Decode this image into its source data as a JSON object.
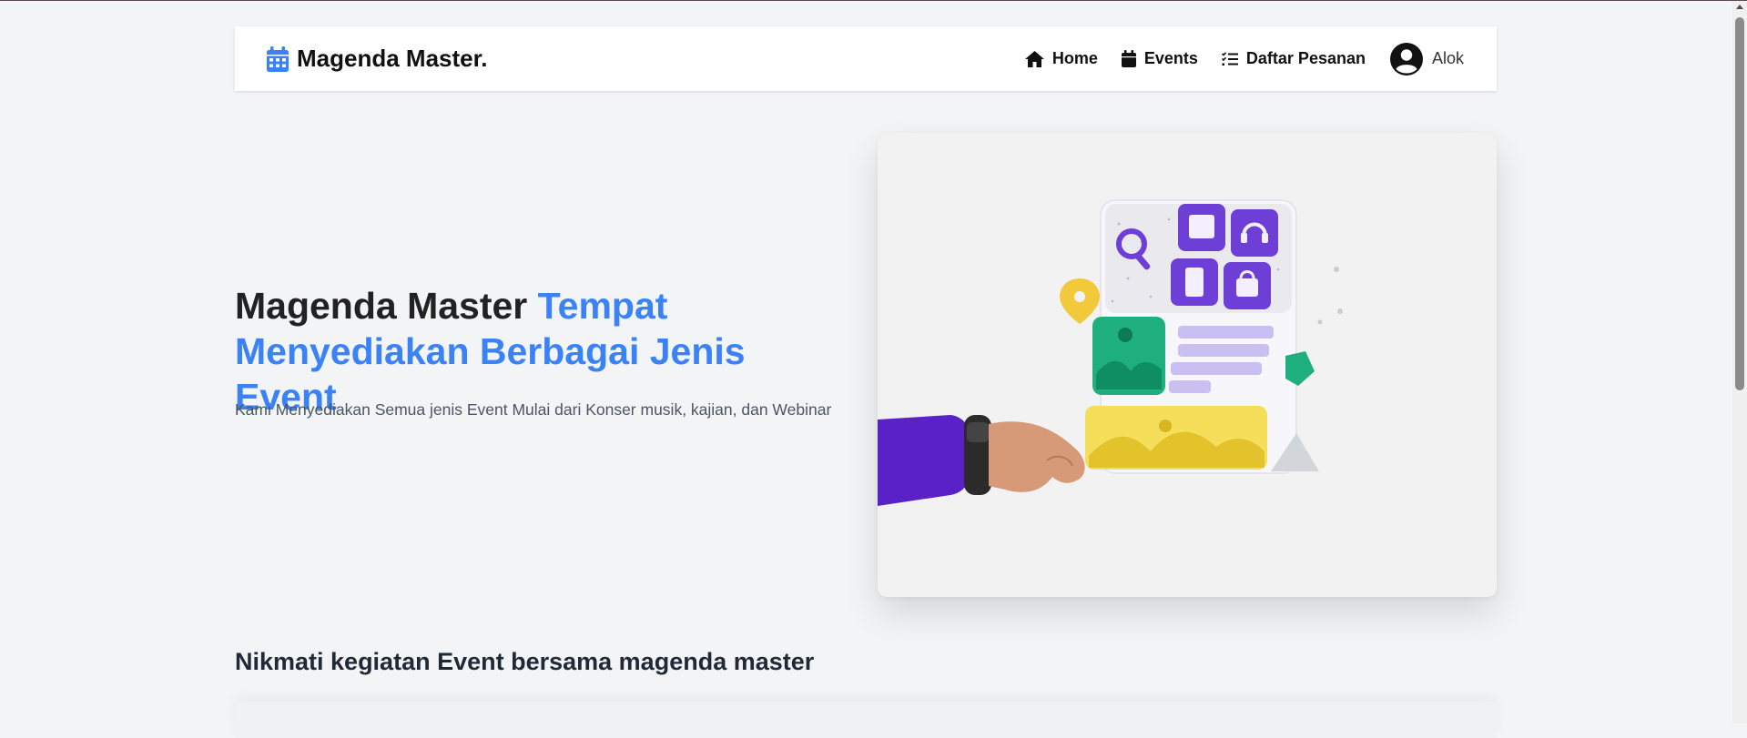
{
  "navbar": {
    "brand": "Magenda Master.",
    "brand_icon": "calendar-icon",
    "items": [
      {
        "label": "Home",
        "icon": "home-icon"
      },
      {
        "label": "Events",
        "icon": "calendar-icon"
      },
      {
        "label": "Daftar Pesanan",
        "icon": "checklist-icon"
      }
    ],
    "user": {
      "name": "Alok",
      "icon": "user-circle-icon"
    }
  },
  "hero": {
    "title_main": "Magenda Master ",
    "title_accent": "Tempat Menyediakan Berbagai Jenis Event",
    "subtitle": "Kami Menyediakan Semua jenis Event Mulai dari Konser musik, kajian, dan Webinar",
    "illustration": "hand-holding-phone-app-illustration"
  },
  "section": {
    "title": "Nikmati kegiatan Event bersama magenda master"
  },
  "colors": {
    "accent": "#3b82f6",
    "background": "#f3f4f6",
    "navbar_bg": "#ffffff",
    "text_dark": "#1f2937"
  }
}
